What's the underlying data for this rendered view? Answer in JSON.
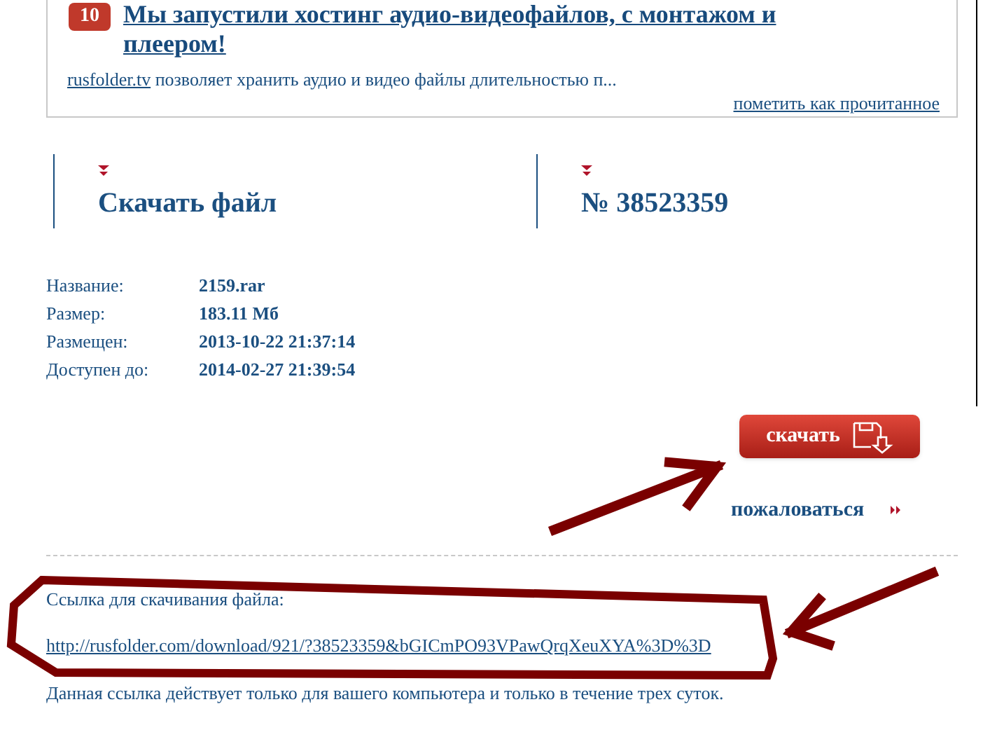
{
  "news_card": {
    "badge": "10",
    "headline_lines": [
      "Мы запустили хостинг аудио-видеофайлов, с монтажом и",
      "плеером!"
    ],
    "summary_link": "rusfolder.tv",
    "summary_text": " позволяет хранить аудио и видео файлы длительностью п...",
    "mark_read": "пометить как прочитанное"
  },
  "headers": [
    {
      "title": "Скачать файл"
    },
    {
      "title": "№ 38523359"
    }
  ],
  "file_info": [
    {
      "label": "Название:",
      "value": "2159.rar"
    },
    {
      "label": "Размер:",
      "value": "183.11 Мб"
    },
    {
      "label": "Размещен:",
      "value": "2013-10-22 21:37:14"
    },
    {
      "label": "Доступен до:",
      "value": "2014-02-27 21:39:54"
    }
  ],
  "download_button": "скачать",
  "complain_link": "пожаловаться",
  "link_section": {
    "label": "Ссылка для скачивания файла:",
    "url": "http://rusfolder.com/download/921/?38523359&bGICmPO93VPawQrqXeuXYA%3D%3D",
    "note": "Данная ссылка действует только для вашего компьютера и только в течение трех суток."
  }
}
